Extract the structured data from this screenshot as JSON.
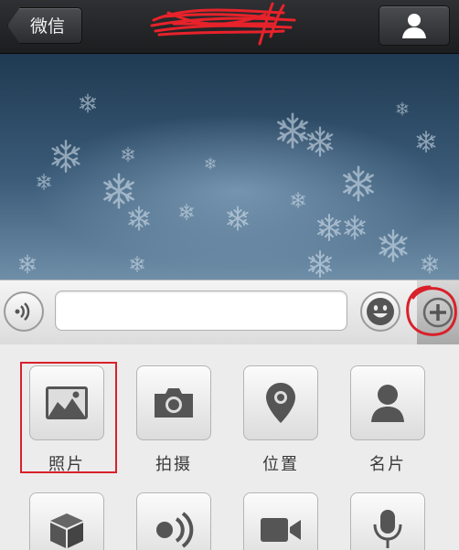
{
  "navbar": {
    "back_label": "微信",
    "title": "",
    "profile_icon": "person-icon"
  },
  "input_bar": {
    "message_value": "",
    "message_placeholder": "",
    "voice_icon": "voice-icon",
    "emoji_icon": "emoji-icon",
    "plus_icon": "plus-icon"
  },
  "attachments": [
    {
      "label": "照片",
      "icon": "photo-icon"
    },
    {
      "label": "拍摄",
      "icon": "camera-icon"
    },
    {
      "label": "位置",
      "icon": "location-pin-icon"
    },
    {
      "label": "名片",
      "icon": "contact-card-icon"
    },
    {
      "label": "",
      "icon": "box-icon"
    },
    {
      "label": "",
      "icon": "voice-input-icon"
    },
    {
      "label": "",
      "icon": "video-call-icon"
    },
    {
      "label": "",
      "icon": "microphone-icon"
    }
  ],
  "colors": {
    "annotation": "#d9202a",
    "navbar": "#26282b",
    "chat_background": "#3b5b78",
    "icon_gray": "#555555"
  }
}
